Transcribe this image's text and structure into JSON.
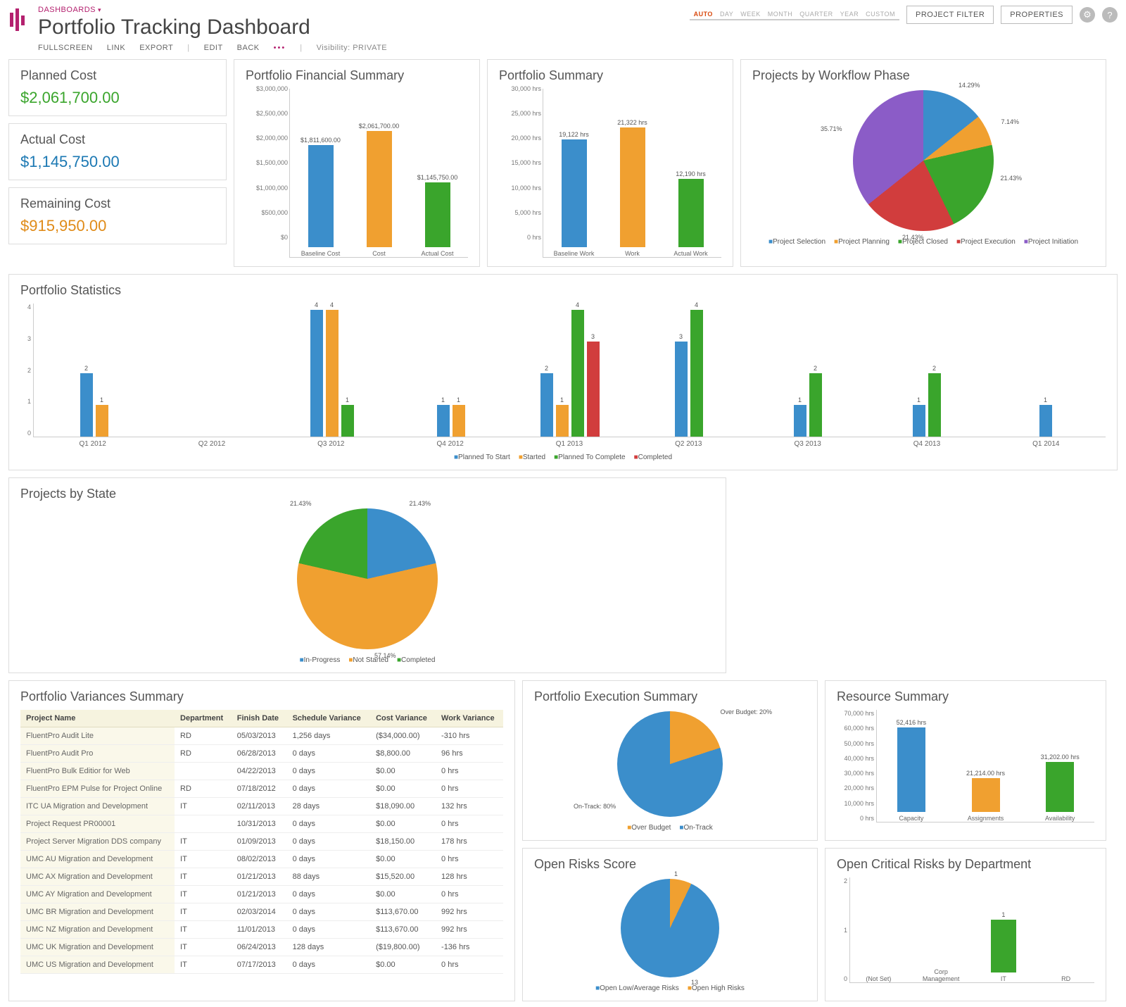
{
  "breadcrumb": "DASHBOARDS",
  "title": "Portfolio Tracking Dashboard",
  "menu": {
    "fullscreen": "FULLSCREEN",
    "link": "LINK",
    "export": "EXPORT",
    "edit": "EDIT",
    "back": "BACK",
    "visibility": "Visibility: PRIVATE"
  },
  "time_range": [
    "AUTO",
    "DAY",
    "WEEK",
    "MONTH",
    "QUARTER",
    "YEAR",
    "CUSTOM"
  ],
  "buttons": {
    "project_filter": "PROJECT FILTER",
    "properties": "PROPERTIES"
  },
  "kpis": {
    "planned": {
      "title": "Planned Cost",
      "value": "$2,061,700.00"
    },
    "actual": {
      "title": "Actual Cost",
      "value": "$1,145,750.00"
    },
    "remaining": {
      "title": "Remaining Cost",
      "value": "$915,950.00"
    }
  },
  "financial": {
    "title": "Portfolio Financial Summary",
    "categories": [
      "Baseline Cost",
      "Cost",
      "Actual Cost"
    ],
    "labels": [
      "$1,811,600.00",
      "$2,061,700.00",
      "$1,145,750.00"
    ]
  },
  "portfolio": {
    "title": "Portfolio Summary",
    "categories": [
      "Baseline Work",
      "Work",
      "Actual Work"
    ],
    "labels": [
      "19,122 hrs",
      "21,322 hrs",
      "12,190 hrs"
    ]
  },
  "workflow": {
    "title": "Projects by Workflow Phase",
    "legend": [
      "Project Selection",
      "Project Planning",
      "Project Closed",
      "Project Execution",
      "Project Initiation"
    ],
    "labels": [
      "14.29%",
      "7.14%",
      "21.43%",
      "21.43%",
      "35.71%"
    ]
  },
  "stats": {
    "title": "Portfolio Statistics",
    "quarters": [
      "Q1 2012",
      "Q2 2012",
      "Q3 2012",
      "Q4 2012",
      "Q1 2013",
      "Q2 2013",
      "Q3 2013",
      "Q4 2013",
      "Q1 2014"
    ],
    "legend": [
      "Planned To Start",
      "Started",
      "Planned To Complete",
      "Completed"
    ]
  },
  "state": {
    "title": "Projects by State",
    "legend": [
      "In-Progress",
      "Not Started",
      "Completed"
    ],
    "labels": [
      "21.43%",
      "57.14%",
      "21.43%"
    ]
  },
  "variances": {
    "title": "Portfolio Variances Summary",
    "headers": [
      "Project Name",
      "Department",
      "Finish Date",
      "Schedule Variance",
      "Cost Variance",
      "Work Variance"
    ],
    "rows": [
      [
        "FluentPro Audit Lite",
        "RD",
        "05/03/2013",
        "1,256 days",
        "($34,000.00)",
        "-310 hrs"
      ],
      [
        "FluentPro Audit Pro",
        "RD",
        "06/28/2013",
        "0 days",
        "$8,800.00",
        "96 hrs"
      ],
      [
        "FluentPro Bulk Editior for Web",
        "",
        "04/22/2013",
        "0 days",
        "$0.00",
        "0 hrs"
      ],
      [
        "FluentPro EPM Pulse for Project Online",
        "RD",
        "07/18/2012",
        "0 days",
        "$0.00",
        "0 hrs"
      ],
      [
        "ITC UA Migration and Development",
        "IT",
        "02/11/2013",
        "28 days",
        "$18,090.00",
        "132 hrs"
      ],
      [
        "Project Request PR00001",
        "",
        "10/31/2013",
        "0 days",
        "$0.00",
        "0 hrs"
      ],
      [
        "Project Server Migration DDS company",
        "IT",
        "01/09/2013",
        "0 days",
        "$18,150.00",
        "178 hrs"
      ],
      [
        "UMC AU Migration and Development",
        "IT",
        "08/02/2013",
        "0 days",
        "$0.00",
        "0 hrs"
      ],
      [
        "UMC AX Migration and Development",
        "IT",
        "01/21/2013",
        "88 days",
        "$15,520.00",
        "128 hrs"
      ],
      [
        "UMC AY Migration and Development",
        "IT",
        "01/21/2013",
        "0 days",
        "$0.00",
        "0 hrs"
      ],
      [
        "UMC BR Migration and Development",
        "IT",
        "02/03/2014",
        "0 days",
        "$113,670.00",
        "992 hrs"
      ],
      [
        "UMC NZ Migration and Development",
        "IT",
        "11/01/2013",
        "0 days",
        "$113,670.00",
        "992 hrs"
      ],
      [
        "UMC UK Migration and Development",
        "IT",
        "06/24/2013",
        "128 days",
        "($19,800.00)",
        "-136 hrs"
      ],
      [
        "UMC US Migration and Development",
        "IT",
        "07/17/2013",
        "0 days",
        "$0.00",
        "0 hrs"
      ]
    ]
  },
  "execution": {
    "title": "Portfolio Execution Summary",
    "labels": [
      "Over Budget: 20%",
      "On-Track: 80%"
    ],
    "legend": [
      "Over Budget",
      "On-Track"
    ]
  },
  "resource": {
    "title": "Resource Summary",
    "categories": [
      "Capacity",
      "Assignments",
      "Availability"
    ],
    "labels": [
      "52,416 hrs",
      "21,214.00 hrs",
      "31,202.00 hrs"
    ]
  },
  "risks": {
    "title": "Open Risks Score",
    "labels": [
      "1",
      "13"
    ],
    "legend": [
      "Open Low/Average Risks",
      "Open High Risks"
    ]
  },
  "critical": {
    "title": "Open Critical Risks by Department",
    "categories": [
      "(Not Set)",
      "Corp Management",
      "IT",
      "RD"
    ],
    "value_label": "1"
  },
  "chart_data": [
    {
      "type": "bar",
      "title": "Portfolio Financial Summary",
      "categories": [
        "Baseline Cost",
        "Cost",
        "Actual Cost"
      ],
      "values": [
        1811600,
        2061700,
        1145750
      ],
      "ylabel": "$",
      "ylim": [
        0,
        3000000
      ]
    },
    {
      "type": "bar",
      "title": "Portfolio Summary",
      "categories": [
        "Baseline Work",
        "Work",
        "Actual Work"
      ],
      "values": [
        19122,
        21322,
        12190
      ],
      "ylabel": "hrs",
      "ylim": [
        0,
        30000
      ]
    },
    {
      "type": "pie",
      "title": "Projects by Workflow Phase",
      "series": [
        {
          "name": "Project Selection",
          "value": 14.29
        },
        {
          "name": "Project Planning",
          "value": 7.14
        },
        {
          "name": "Project Closed",
          "value": 21.43
        },
        {
          "name": "Project Execution",
          "value": 21.43
        },
        {
          "name": "Project Initiation",
          "value": 35.71
        }
      ]
    },
    {
      "type": "bar",
      "title": "Portfolio Statistics",
      "categories": [
        "Q1 2012",
        "Q2 2012",
        "Q3 2012",
        "Q4 2012",
        "Q1 2013",
        "Q2 2013",
        "Q3 2013",
        "Q4 2013",
        "Q1 2014"
      ],
      "series": [
        {
          "name": "Planned To Start",
          "values": [
            2,
            0,
            4,
            1,
            2,
            3,
            1,
            1,
            1
          ]
        },
        {
          "name": "Started",
          "values": [
            1,
            0,
            4,
            1,
            1,
            0,
            0,
            0,
            0
          ]
        },
        {
          "name": "Planned To Complete",
          "values": [
            0,
            0,
            1,
            0,
            4,
            4,
            2,
            2,
            0
          ]
        },
        {
          "name": "Completed",
          "values": [
            0,
            0,
            0,
            0,
            3,
            0,
            0,
            0,
            0
          ]
        }
      ],
      "ylim": [
        0,
        4
      ]
    },
    {
      "type": "pie",
      "title": "Projects by State",
      "series": [
        {
          "name": "In-Progress",
          "value": 21.43
        },
        {
          "name": "Not Started",
          "value": 57.14
        },
        {
          "name": "Completed",
          "value": 21.43
        }
      ]
    },
    {
      "type": "pie",
      "title": "Portfolio Execution Summary",
      "series": [
        {
          "name": "Over Budget",
          "value": 20
        },
        {
          "name": "On-Track",
          "value": 80
        }
      ]
    },
    {
      "type": "bar",
      "title": "Resource Summary",
      "categories": [
        "Capacity",
        "Assignments",
        "Availability"
      ],
      "values": [
        52416,
        21214,
        31202
      ],
      "ylabel": "hrs",
      "ylim": [
        0,
        70000
      ]
    },
    {
      "type": "pie",
      "title": "Open Risks Score",
      "series": [
        {
          "name": "Open Low/Average Risks",
          "value": 13
        },
        {
          "name": "Open High Risks",
          "value": 1
        }
      ]
    },
    {
      "type": "bar",
      "title": "Open Critical Risks by Department",
      "categories": [
        "(Not Set)",
        "Corp Management",
        "IT",
        "RD"
      ],
      "values": [
        0,
        0,
        1,
        0
      ],
      "ylim": [
        0,
        2
      ]
    }
  ]
}
